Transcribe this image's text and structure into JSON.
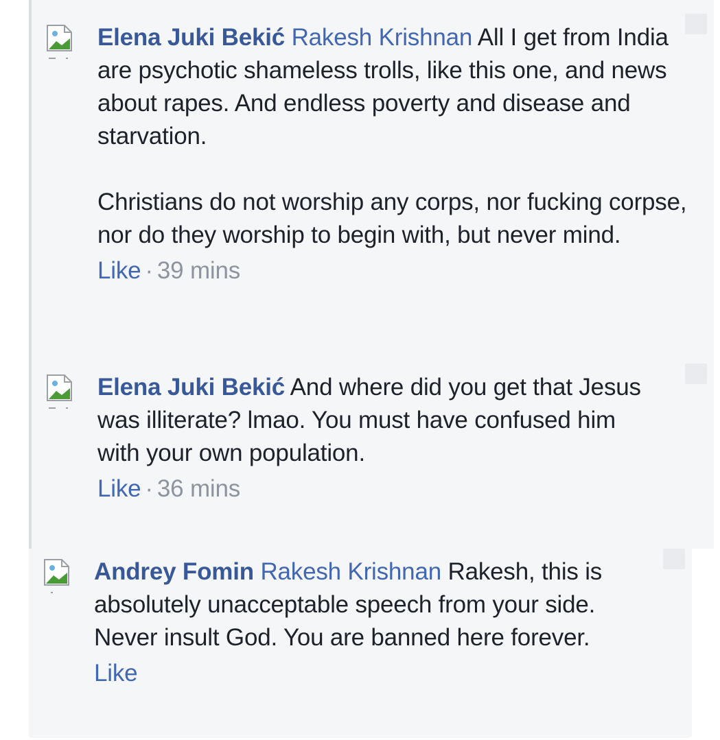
{
  "comments": [
    {
      "author": "Elena Juki Bekić",
      "mention": "Rakesh Krishnan",
      "paragraphs": [
        "All I get from India are psychotic shameless trolls, like this one, and news about rapes. And endless poverty and disease and starvation.",
        "Christians do not worship any corps, nor fucking corpse, nor do they worship to begin with, but never mind."
      ],
      "like_label": "Like",
      "separator": "·",
      "time": "39 mins"
    },
    {
      "author": "Elena Juki Bekić",
      "mention": "",
      "paragraphs": [
        "And where did you get that Jesus was illiterate? lmao. You must have confused him with your own population."
      ],
      "like_label": "Like",
      "separator": "·",
      "time": "36 mins"
    },
    {
      "author": "Andrey Fomin",
      "mention": "Rakesh Krishnan",
      "paragraphs": [
        "Rakesh, this is absolutely unacceptable speech from your side. Never insult God. You are banned here forever."
      ],
      "like_label": "Like"
    }
  ],
  "icons": {
    "avatar": "broken-image-icon",
    "options": "more-options-icon"
  },
  "colors": {
    "author": "#385898",
    "link": "#4267b2",
    "muted": "#8d949e",
    "background": "#f5f6f8"
  }
}
